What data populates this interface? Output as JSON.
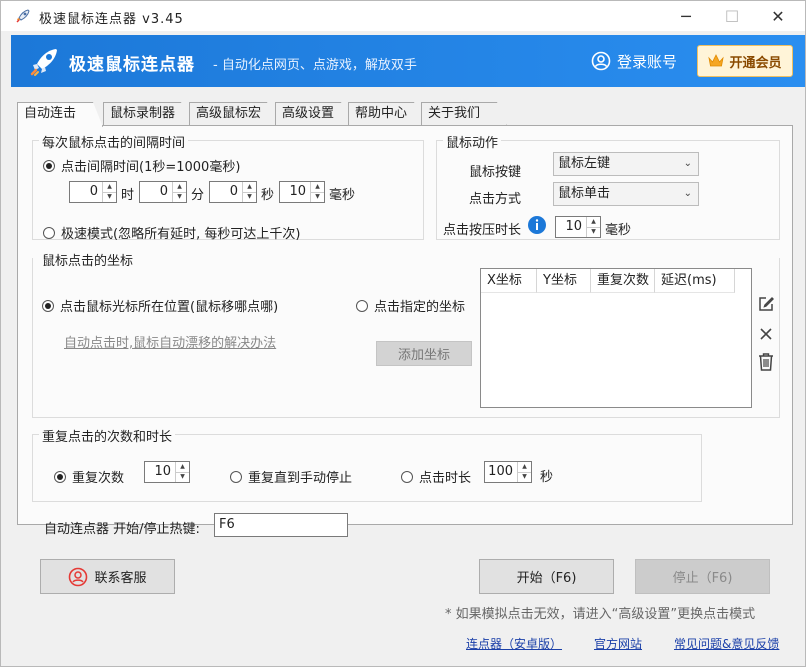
{
  "window": {
    "title": "极速鼠标连点器 v3.45",
    "minimize_glyph": "─",
    "maximize_glyph": "☐",
    "close_glyph": "✕"
  },
  "header": {
    "brand": "极速鼠标连点器",
    "slogan": "- 自动化点网页、点游戏，解放双手",
    "login": "登录账号",
    "vip": "开通会员"
  },
  "tabs": [
    {
      "label": "自动连击器",
      "active": true
    },
    {
      "label": "鼠标录制器",
      "active": false
    },
    {
      "label": "高级鼠标宏",
      "active": false
    },
    {
      "label": "高级设置",
      "active": false
    },
    {
      "label": "帮助中心",
      "active": false
    },
    {
      "label": "关于我们",
      "active": false
    }
  ],
  "interval": {
    "legend": "每次鼠标点击的间隔时间",
    "option_interval": "点击间隔时间(1秒=1000毫秒)",
    "hours": "0",
    "hours_unit": "时",
    "minutes": "0",
    "minutes_unit": "分",
    "seconds": "0",
    "seconds_unit": "秒",
    "ms": "10",
    "ms_unit": "毫秒",
    "option_fast": "极速模式(忽略所有延时, 每秒可达上千次)",
    "selected": "interval"
  },
  "action": {
    "legend": "鼠标动作",
    "button_label": "鼠标按键",
    "button_value": "鼠标左键",
    "mode_label": "点击方式",
    "mode_value": "鼠标单击",
    "press_label": "点击按压时长",
    "press_value": "10",
    "press_unit": "毫秒"
  },
  "coords": {
    "legend": "鼠标点击的坐标",
    "option_cursor": "点击鼠标光标所在位置(鼠标移哪点哪)",
    "option_fixed": "点击指定的坐标",
    "drift_link": "自动点击时,鼠标自动漂移的解决办法",
    "add_button": "添加坐标",
    "columns": [
      "X坐标",
      "Y坐标",
      "重复次数",
      "延迟(ms)"
    ],
    "selected": "cursor"
  },
  "repeat": {
    "legend": "重复点击的次数和时长",
    "option_count": "重复次数",
    "count_value": "10",
    "option_until_stop": "重复直到手动停止",
    "option_duration": "点击时长",
    "duration_value": "100",
    "duration_unit": "秒",
    "selected": "count"
  },
  "hotkey": {
    "label": "自动连点器 开始/停止热键:",
    "value": "F6"
  },
  "buttons": {
    "support": "联系客服",
    "start": "开始（F6)",
    "stop": "停止（F6)"
  },
  "hint": "* 如果模拟点击无效，请进入“高级设置”更换点击模式",
  "footer": {
    "android": "连点器（安卓版）",
    "website": "官方网站",
    "faq": "常见问题&意见反馈"
  },
  "colors": {
    "header_blue": "#1c78d8",
    "vip_bg": "#fff4d8",
    "support_icon": "#e53935",
    "link_blue": "#1a3fa8"
  }
}
